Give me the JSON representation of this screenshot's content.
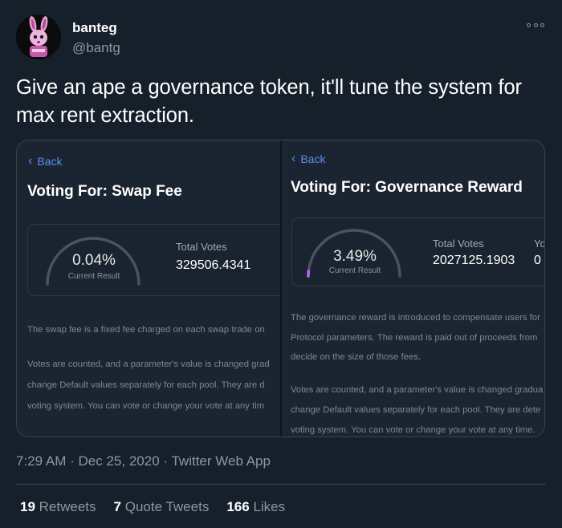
{
  "author": {
    "display_name": "banteg",
    "handle": "@bantg",
    "avatar_icon": "pink-rabbit-avatar-icon"
  },
  "more_icon": "more-horizontal-icon",
  "tweet": {
    "text": "Give an ape a governance token, it'll tune the system for max rent extraction."
  },
  "media": {
    "left": {
      "back_label": "Back",
      "title": "Voting For: Swap Fee",
      "current_result": 0.04,
      "current_result_text": "0.04%",
      "current_result_label": "Current Result",
      "total_votes_label": "Total Votes",
      "total_votes_value": "329506.4341",
      "description_lines": [
        "The swap fee is a fixed fee charged on each swap trade on",
        "Votes are counted, and a parameter's value is changed grad",
        "change Default values separately for each pool. They are d",
        "voting system. You can vote or change your vote at any tim"
      ]
    },
    "right": {
      "back_label": "Back",
      "title": "Voting For: Governance Reward",
      "current_result": 3.49,
      "current_result_text": "3.49%",
      "current_result_label": "Current Result",
      "total_votes_label": "Total Votes",
      "total_votes_value": "2027125.1903",
      "extra_label": "Yo",
      "extra_value": "0",
      "description_lines": [
        "The governance reward is introduced to compensate users for",
        "Protocol parameters. The reward is paid out of proceeds from",
        "decide on the size of those fees.",
        "Votes are counted, and a parameter's value is changed gradua",
        "change Default values separately for each pool. They are dete",
        "voting system. You can vote or change your vote at any time."
      ]
    },
    "accent_color": "#5b8def",
    "gauge_fill_color": "#c45df5"
  },
  "timestamp": {
    "time": "7:29 AM",
    "separator": "·",
    "date": "Dec 25, 2020",
    "source": "Twitter Web App"
  },
  "stats": {
    "retweets_count": "19",
    "retweets_label": "Retweets",
    "quotes_count": "7",
    "quotes_label": "Quote Tweets",
    "likes_count": "166",
    "likes_label": "Likes"
  }
}
